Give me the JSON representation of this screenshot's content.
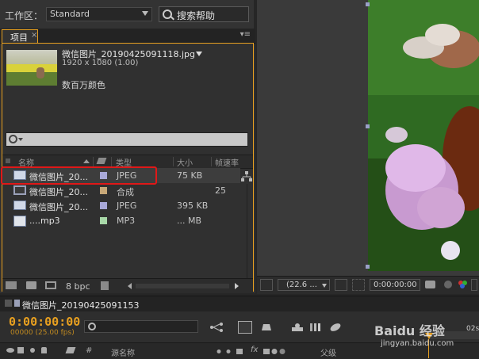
{
  "workspace": {
    "label": "工作区：",
    "preset": "Standard",
    "help_search": "搜索帮助"
  },
  "project_panel": {
    "tab_label": "项目",
    "tab_close": "×",
    "menu": "▾≡",
    "preview": {
      "file_name": "微信图片_20190425091118.jpg",
      "resolution": "1920 x 1080 (1.00)",
      "color_depth": "数百万颜色"
    },
    "columns": {
      "name": "名称",
      "type": "类型",
      "size": "大小",
      "frame_rate": "帧速率"
    },
    "rows": [
      {
        "name": "微信图片_20...",
        "type": "JPEG",
        "size": "75 KB",
        "rate": "",
        "label_color": "#a8a8d8",
        "icon": "image-icon"
      },
      {
        "name": "微信图片_20...",
        "type": "合成",
        "size": "",
        "rate": "25",
        "label_color": "#c8a878",
        "icon": "composition-icon"
      },
      {
        "name": "微信图片_20...",
        "type": "JPEG",
        "size": "395 KB",
        "rate": "",
        "label_color": "#a8a8d8",
        "icon": "image-icon"
      },
      {
        "name": "....mp3",
        "type": "MP3",
        "size": "... MB",
        "rate": "",
        "label_color": "#a8d8a8",
        "icon": "audio-icon"
      }
    ],
    "bpc": "8 bpc"
  },
  "viewer": {
    "zoom": "(22.6 ...",
    "timecode": "0:00:00:00"
  },
  "timeline": {
    "tab_label": "微信图片_20190425091153",
    "current_time": "0:00:00:00",
    "frames": "00000 (25.00 fps)",
    "ruler_label": "02s",
    "col_hash": "#",
    "col_source_name": "源名称",
    "col_parent": "父级"
  },
  "watermark": {
    "brand": "Baidu 经验",
    "url": "jingyan.baidu.com"
  },
  "colors": {
    "accent": "#e8a020",
    "highlight_box": "#e01818",
    "panel_bg": "#303030"
  }
}
